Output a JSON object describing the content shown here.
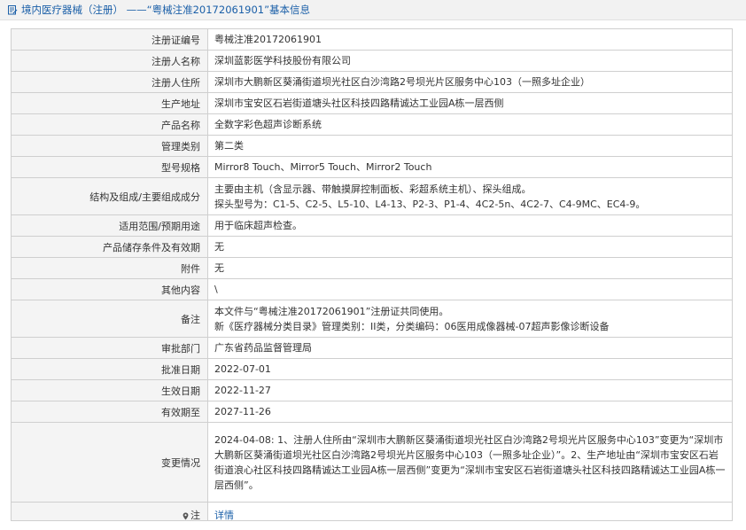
{
  "header": {
    "title": "境内医疗器械（注册） ——“粤械注准20172061901”基本信息"
  },
  "rows": [
    {
      "label": "注册证编号",
      "value": [
        "粤械注准20172061901"
      ]
    },
    {
      "label": "注册人名称",
      "value": [
        "深圳蓝影医学科技股份有限公司"
      ]
    },
    {
      "label": "注册人住所",
      "value": [
        "深圳市大鹏新区葵涌街道坝光社区白沙湾路2号坝光片区服务中心103（一照多址企业）"
      ]
    },
    {
      "label": "生产地址",
      "value": [
        "深圳市宝安区石岩街道塘头社区科技四路精诚达工业园A栋一层西侧"
      ]
    },
    {
      "label": "产品名称",
      "value": [
        "全数字彩色超声诊断系统"
      ]
    },
    {
      "label": "管理类别",
      "value": [
        "第二类"
      ]
    },
    {
      "label": "型号规格",
      "value": [
        "Mirror8 Touch、Mirror5 Touch、Mirror2 Touch"
      ]
    },
    {
      "label": "结构及组成/主要组成成分",
      "value": [
        "主要由主机（含显示器、带触摸屏控制面板、彩超系统主机）、探头组成。",
        "探头型号为：C1-5、C2-5、L5-10、L4-13、P2-3、P1-4、4C2-5n、4C2-7、C4-9MC、EC4-9。"
      ]
    },
    {
      "label": "适用范围/预期用途",
      "value": [
        "用于临床超声检查。"
      ]
    },
    {
      "label": "产品储存条件及有效期",
      "value": [
        "无"
      ]
    },
    {
      "label": "附件",
      "value": [
        "无"
      ]
    },
    {
      "label": "其他内容",
      "value": [
        "\\"
      ]
    },
    {
      "label": "备注",
      "value": [
        "本文件与“粤械注准20172061901”注册证共同使用。",
        "新《医疗器械分类目录》管理类别：II类，分类编码：06医用成像器械-07超声影像诊断设备"
      ]
    },
    {
      "label": "审批部门",
      "value": [
        "广东省药品监督管理局"
      ]
    },
    {
      "label": "批准日期",
      "value": [
        "2022-07-01"
      ]
    },
    {
      "label": "生效日期",
      "value": [
        "2022-11-27"
      ]
    },
    {
      "label": "有效期至",
      "value": [
        "2027-11-26"
      ]
    }
  ],
  "change": {
    "label": "变更情况",
    "text": "2024-04-08: 1、注册人住所由“深圳市大鹏新区葵涌街道坝光社区白沙湾路2号坝光片区服务中心103”变更为“深圳市大鹏新区葵涌街道坝光社区白沙湾路2号坝光片区服务中心103（一照多址企业）”。2、生产地址由“深圳市宝安区石岩街道浪心社区科技四路精诚达工业园A栋一层西侧”变更为“深圳市宝安区石岩街道塘头社区科技四路精诚达工业园A栋一层西侧”。"
  },
  "note": {
    "label": "注",
    "link": "详情"
  },
  "icons": {
    "header": "edit-document-icon",
    "note": "map-pin-icon"
  },
  "colors": {
    "link": "#1a5fa8",
    "label_bg": "#f4f4f4",
    "border": "#cfcfcf"
  }
}
